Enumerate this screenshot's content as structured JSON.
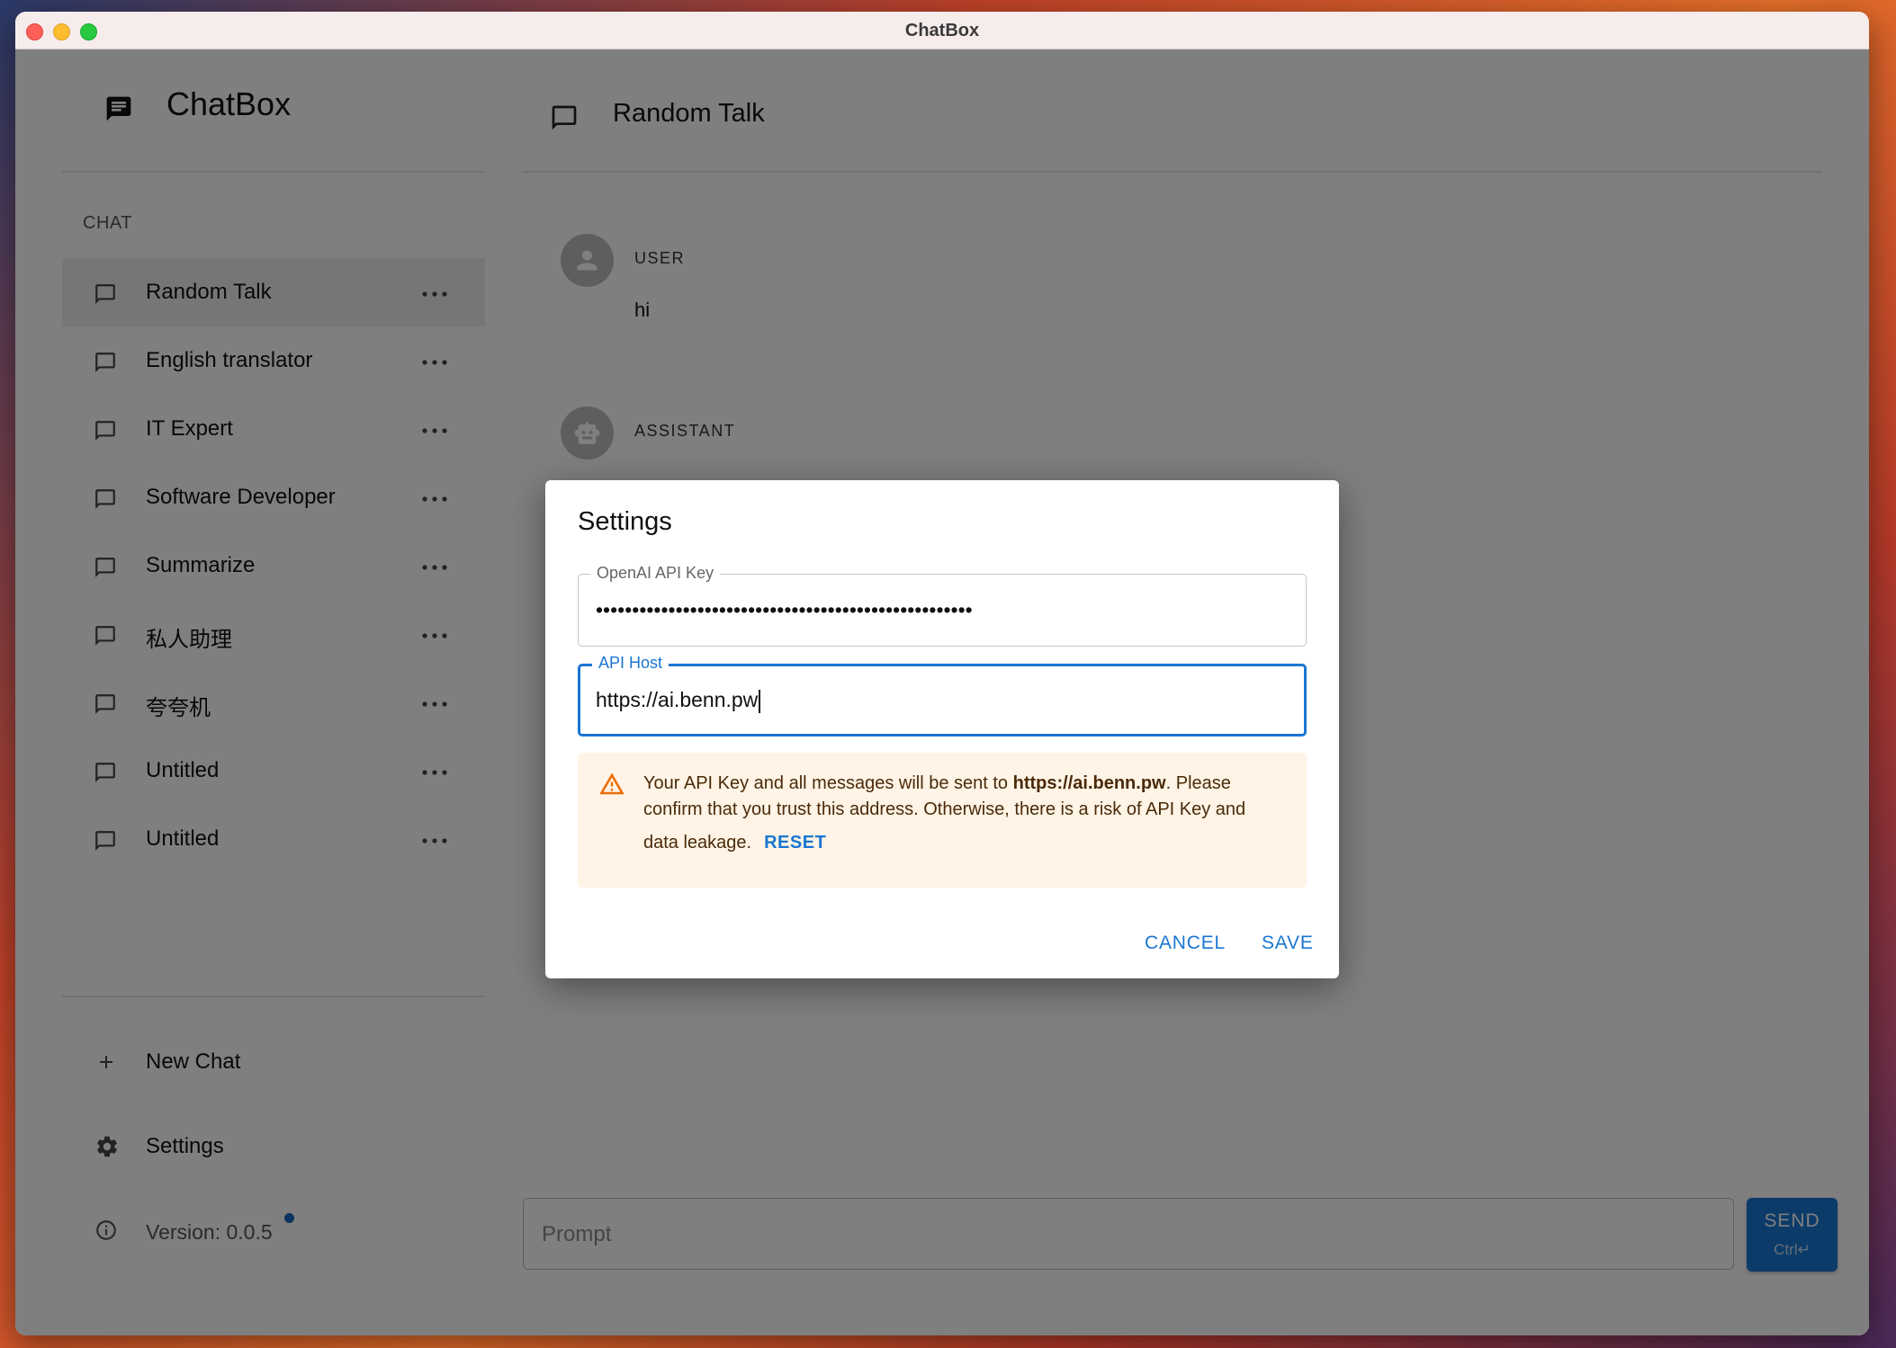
{
  "window": {
    "title": "ChatBox"
  },
  "sidebar": {
    "brand": "ChatBox",
    "section_label": "CHAT",
    "chats": [
      {
        "label": "Random Talk",
        "active": true
      },
      {
        "label": "English translator"
      },
      {
        "label": "IT Expert"
      },
      {
        "label": "Software Developer"
      },
      {
        "label": "Summarize"
      },
      {
        "label": "私人助理"
      },
      {
        "label": "夸夸机"
      },
      {
        "label": "Untitled"
      },
      {
        "label": "Untitled"
      }
    ],
    "new_chat_label": "New Chat",
    "settings_label": "Settings",
    "version_label": "Version: 0.0.5"
  },
  "main": {
    "title": "Random Talk",
    "messages": [
      {
        "role": "USER",
        "text": "hi"
      },
      {
        "role": "ASSISTANT",
        "text": ""
      }
    ],
    "prompt_placeholder": "Prompt",
    "send_label": "SEND",
    "send_hint": "Ctrl↵"
  },
  "dialog": {
    "title": "Settings",
    "api_key_label": "OpenAI API Key",
    "api_key_value": "••••••••••••••••••••••••••••••••••••••••••••••••••••",
    "api_host_label": "API Host",
    "api_host_value": "https://ai.benn.pw",
    "warning": {
      "prefix": "Your API Key and all messages will be sent to ",
      "host": "https://ai.benn.pw",
      "suffix": ". Please confirm that you trust this address. Otherwise, there is a risk of API Key and",
      "line3": "data leakage.",
      "reset_label": "RESET"
    },
    "cancel_label": "CANCEL",
    "save_label": "SAVE"
  },
  "colors": {
    "accent": "#1976d2",
    "warning_bg": "#fff4e5",
    "warning_icon": "#ed6c02",
    "overlay": "rgba(0,0,0,0.5)"
  }
}
